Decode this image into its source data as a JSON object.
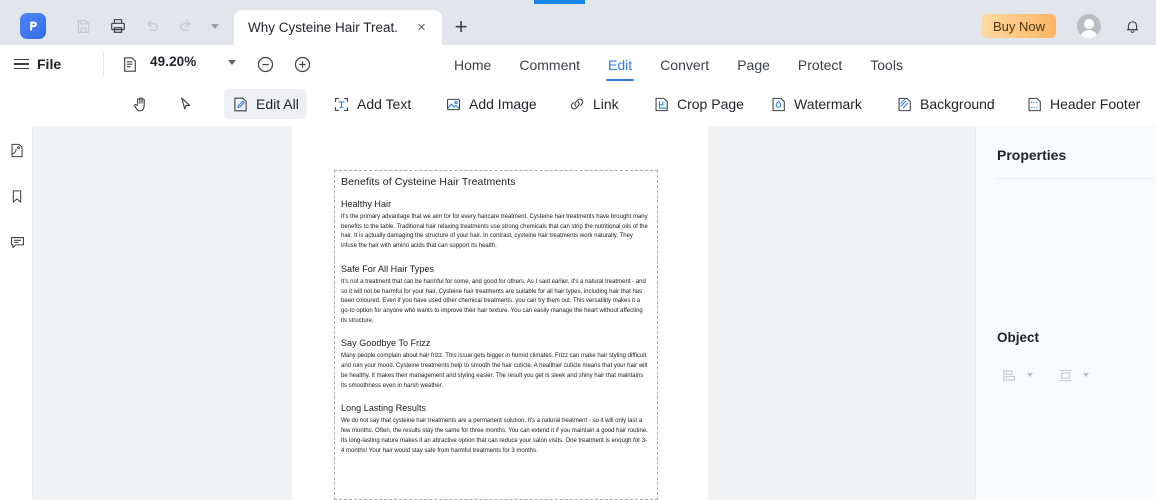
{
  "window": {
    "progress_accent": "#1785eb"
  },
  "titlebar": {
    "logo_icon": "pdf-app-logo-icon",
    "quick_actions": [
      {
        "name": "save-icon",
        "label": "Save",
        "disabled": true
      },
      {
        "name": "print-icon",
        "label": "Print",
        "disabled": false
      },
      {
        "name": "undo-icon",
        "label": "Undo",
        "disabled": true
      },
      {
        "name": "redo-icon",
        "label": "Redo",
        "disabled": true
      },
      {
        "name": "chevron-down-icon",
        "label": "More",
        "disabled": true
      }
    ],
    "tab_title": "Why Cysteine Hair Treat...",
    "tab_close": "×",
    "new_tab": "+",
    "buy_now": "Buy Now",
    "avatar_icon": "user-avatar-icon",
    "bell_icon": "notification-bell-icon"
  },
  "menubar": {
    "file_label": "File",
    "page_mode_icon": "page-layout-icon",
    "zoom_value": "49.20%",
    "zoom_out": "−",
    "zoom_in": "+",
    "tabs": [
      {
        "label": "Home",
        "active": false
      },
      {
        "label": "Comment",
        "active": false
      },
      {
        "label": "Edit",
        "active": true
      },
      {
        "label": "Convert",
        "active": false
      },
      {
        "label": "Page",
        "active": false
      },
      {
        "label": "Protect",
        "active": false
      },
      {
        "label": "Tools",
        "active": false
      }
    ],
    "active_tab_color": "#2f7de1"
  },
  "toolbar": {
    "hand_icon": "hand-tool-icon",
    "select_icon": "select-cursor-icon",
    "items": [
      {
        "label": "Edit All",
        "icon": "edit-all-icon",
        "active": true
      },
      {
        "label": "Add Text",
        "icon": "add-text-icon",
        "active": false
      },
      {
        "label": "Add Image",
        "icon": "add-image-icon",
        "active": false
      },
      {
        "label": "Link",
        "icon": "link-icon",
        "active": false
      },
      {
        "label": "Crop Page",
        "icon": "crop-page-icon",
        "active": false
      },
      {
        "label": "Watermark",
        "icon": "watermark-icon",
        "active": false
      },
      {
        "label": "Background",
        "icon": "background-icon",
        "active": false
      },
      {
        "label": "Header Footer",
        "icon": "header-footer-icon",
        "active": false
      }
    ]
  },
  "leftrail": {
    "items": [
      {
        "name": "thumbnail-icon",
        "label": "Thumbnails"
      },
      {
        "name": "bookmark-icon",
        "label": "Bookmarks"
      },
      {
        "name": "comment-icon",
        "label": "Comments"
      }
    ]
  },
  "document": {
    "title": "Benefits of Cysteine Hair Treatments",
    "sections": [
      {
        "heading": "Healthy Hair",
        "body": "It's the primary advantage that we aim for for every haircare treatment. Cysteine hair treatments have brought many benefits to the table. Traditional hair relaxing treatments use strong chemicals that can strip the nutritional oils of the hair. It is actually damaging the structure of your hair. In contrast, cysteine hair treatments work naturally. They infuse the hair with amino acids that can support its health."
      },
      {
        "heading": "Safe For All Hair Types",
        "body": "It's not a treatment that can be harmful for some, and good for others. As I said earlier, it's a natural treatment - and so it will not be harmful for your hair. Cysteine hair treatments are suitable for all hair types, including hair that has been coloured. Even if you have used other chemical treatments, you can try them out. This versatility makes it a go-to option for anyone who wants to improve their hair texture. You can easily manage the heart without affecting its structure."
      },
      {
        "heading": "Say Goodbye To Frizz",
        "body": "Many people complain about hair frizz. This issue gets bigger in humid climates. Frizz can make hair styling difficult and ruin your mood. Cysteine treatments help to smooth the hair cuticle. A healthier cuticle means that your hair will be healthy. It makes their management and styling easier. The result you get is sleek and shiny hair that maintains its smoothness even in harsh weather."
      },
      {
        "heading": "Long Lasting Results",
        "body": "We do not say that cysteine hair treatments are a permanent solution. It's a natural treatment - so it will only last a few months. Often, the results stay the same for three months. You can extend it if you maintain a good hair routine. Its long-lasting nature makes it an attractive option that can reduce your salon visits. One treatment is enough for 3-4 months! Your hair would stay safe from harmful treatments for 3 months."
      }
    ]
  },
  "rightpanel": {
    "title": "Properties",
    "object_label": "Object",
    "object_tools": [
      {
        "name": "align-objects-icon",
        "label": "Align"
      },
      {
        "name": "distribute-objects-icon",
        "label": "Distribute"
      }
    ]
  }
}
